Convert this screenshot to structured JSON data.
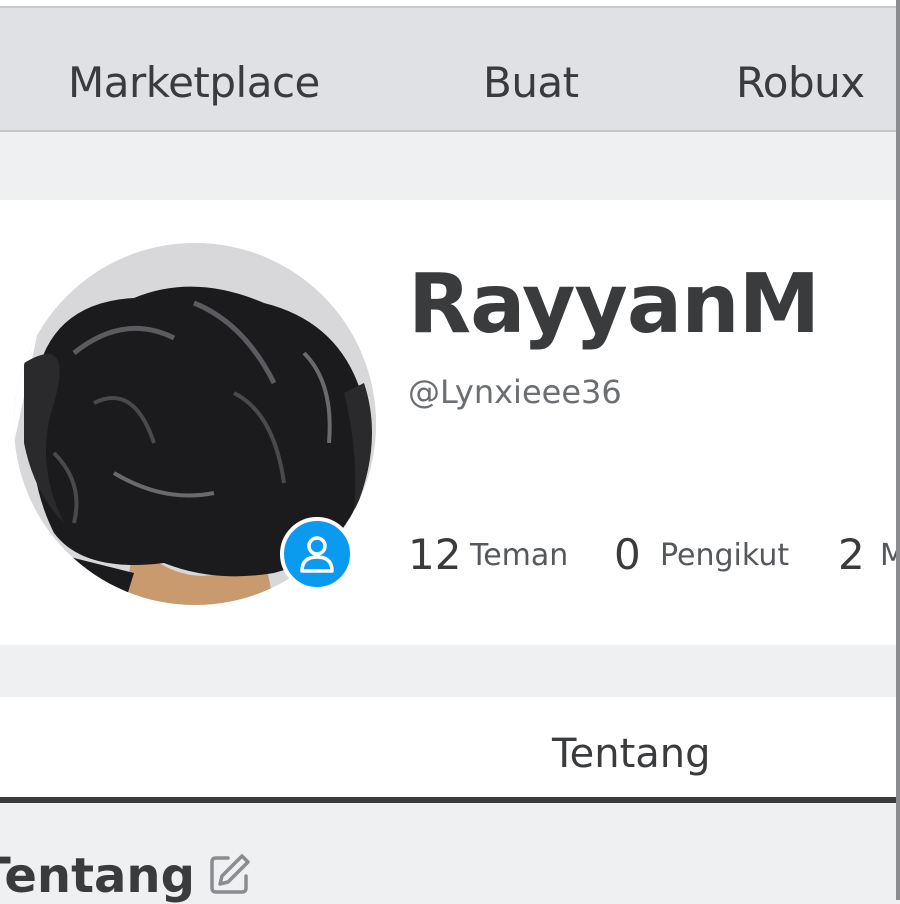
{
  "nav": {
    "items": [
      {
        "label": "Marketplace"
      },
      {
        "label": "Buat"
      },
      {
        "label": "Robux"
      }
    ]
  },
  "profile": {
    "display_name": "RayyanM",
    "username": "@Lynxieee36",
    "avatar_icon": "avatar-image",
    "badge_icon": "user-icon",
    "badge_color": "#0a9bf0",
    "stats": {
      "friends": {
        "count": "12",
        "label": "Teman"
      },
      "followers": {
        "count": "0",
        "label": "Pengikut"
      },
      "following": {
        "count": "2",
        "label": "M"
      }
    }
  },
  "tabs": [
    {
      "label": "Tentang",
      "active": true
    }
  ],
  "about": {
    "title": "Tentang",
    "edit_icon": "pencil-icon"
  }
}
